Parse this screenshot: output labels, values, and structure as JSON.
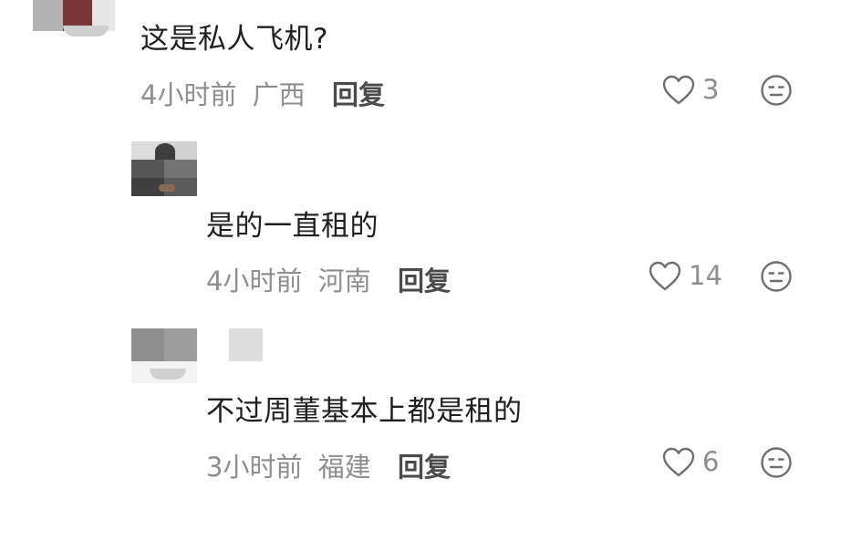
{
  "comments": [
    {
      "text": "这是私人飞机?",
      "time": "4小时前",
      "location": "广西",
      "reply_label": "回复",
      "likes": "3",
      "like_icon": "heart-icon",
      "dislike_icon": "meh-face-icon"
    },
    {
      "text": "是的一直租的",
      "time": "4小时前",
      "location": "河南",
      "reply_label": "回复",
      "likes": "14",
      "like_icon": "heart-icon",
      "dislike_icon": "meh-face-icon"
    },
    {
      "text": "不过周董基本上都是租的",
      "time": "3小时前",
      "location": "福建",
      "reply_label": "回复",
      "likes": "6",
      "like_icon": "heart-icon",
      "dislike_icon": "meh-face-icon"
    }
  ],
  "colors": {
    "background": "#ffffff",
    "text_main": "#1f1f1f",
    "text_meta": "#8e8e8e",
    "reply": "#4a4a4a",
    "icon": "#6f6f6f"
  }
}
